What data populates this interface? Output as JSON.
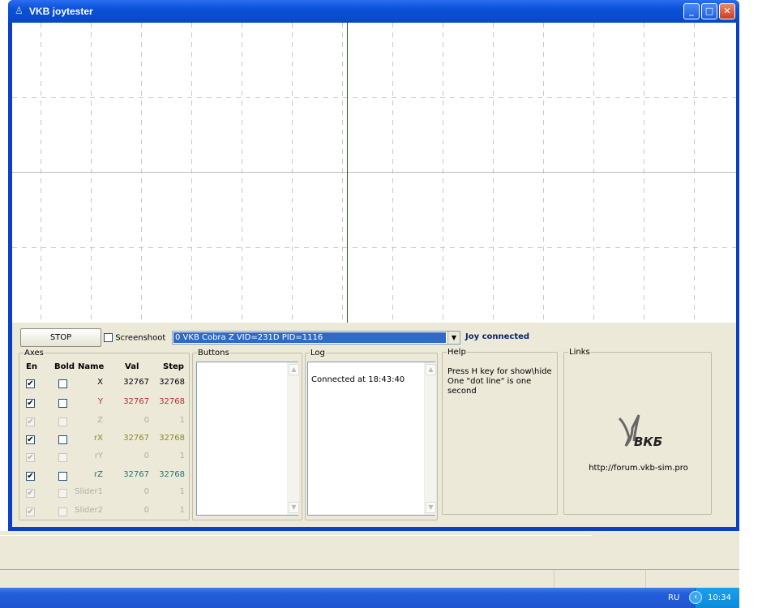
{
  "window": {
    "title": "VKB joytester"
  },
  "controls": {
    "stop_label": "STOP",
    "screenshot_label": "Screenshoot",
    "screenshot_checked": false,
    "device_selected": "0 VKB Cobra Z VID=231D PID=1116",
    "status": "Joy connected"
  },
  "axes": {
    "title": "Axes",
    "headers": {
      "en": "En",
      "bold": "Bold",
      "name": "Name",
      "val": "Val",
      "step": "Step"
    },
    "rows": [
      {
        "name": "X",
        "val": "32767",
        "step": "32768",
        "enabled": true,
        "active": true,
        "bold": false,
        "color": "#000000"
      },
      {
        "name": "Y",
        "val": "32767",
        "step": "32768",
        "enabled": true,
        "active": true,
        "bold": false,
        "color": "#b03030"
      },
      {
        "name": "Z",
        "val": "0",
        "step": "1",
        "enabled": true,
        "active": false,
        "bold": false,
        "color": "#b0aea4"
      },
      {
        "name": "rX",
        "val": "32767",
        "step": "32768",
        "enabled": true,
        "active": true,
        "bold": false,
        "color": "#8a8a20"
      },
      {
        "name": "rY",
        "val": "0",
        "step": "1",
        "enabled": true,
        "active": false,
        "bold": false,
        "color": "#b0aea4"
      },
      {
        "name": "rZ",
        "val": "32767",
        "step": "32768",
        "enabled": true,
        "active": true,
        "bold": false,
        "color": "#207870"
      },
      {
        "name": "Slider1",
        "val": "0",
        "step": "1",
        "enabled": true,
        "active": false,
        "bold": false,
        "color": "#b0aea4"
      },
      {
        "name": "Slider2",
        "val": "0",
        "step": "1",
        "enabled": true,
        "active": false,
        "bold": false,
        "color": "#b0aea4"
      }
    ]
  },
  "buttons": {
    "title": "Buttons"
  },
  "log": {
    "title": "Log",
    "entries": [
      "Connected at 18:43:40"
    ]
  },
  "help": {
    "title": "Help",
    "line1": "Press H key for show\\hide",
    "line2": "One \"dot line\" is one second"
  },
  "links": {
    "title": "Links",
    "logo_text": "ВКБ",
    "url": "http://forum.vkb-sim.pro"
  },
  "taskbar": {
    "lang": "RU",
    "clock": "10:34"
  },
  "colors": {
    "center_line": "#2a6a2a",
    "grid": "#c8c8c8"
  }
}
